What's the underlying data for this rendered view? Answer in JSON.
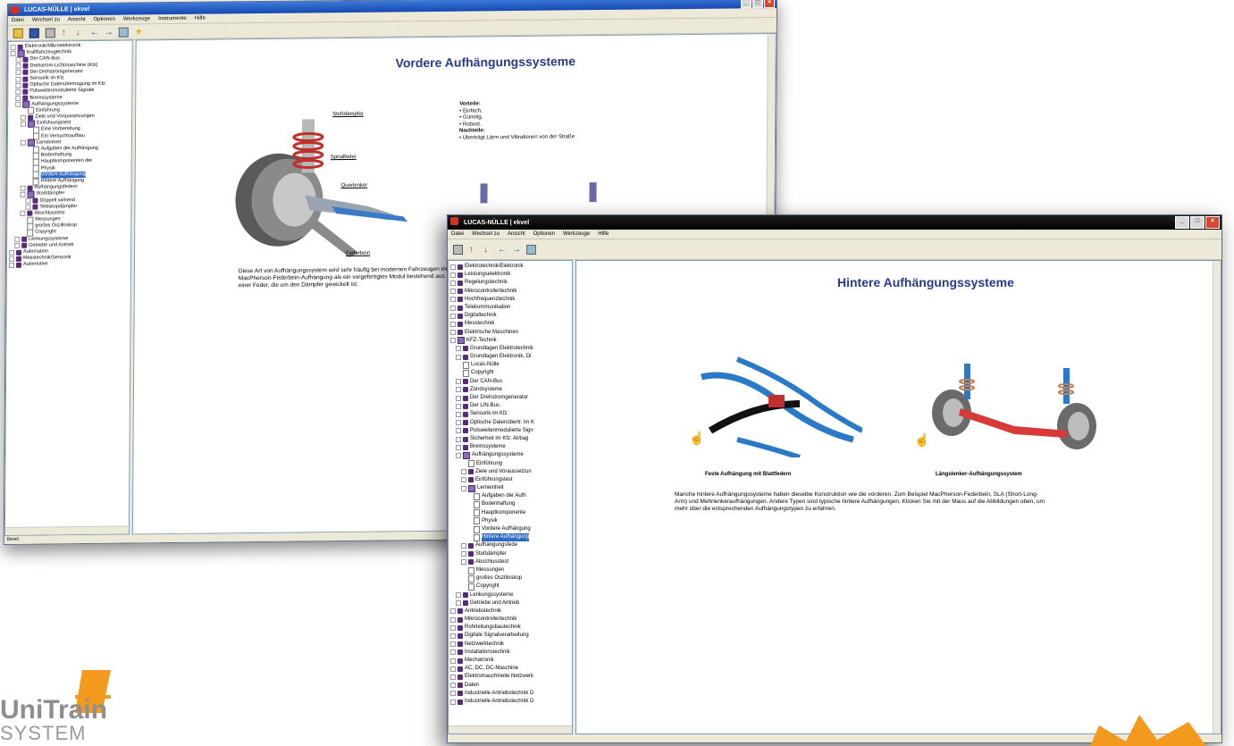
{
  "window1": {
    "title": "LUCAS-NÜLLE | ekvel",
    "menu": [
      "Datei",
      "Wechsel zu",
      "Ansicht",
      "Optionen",
      "Werkzeuge",
      "Instrumente",
      "Hilfe"
    ],
    "page_title": "Vordere Aufhängungssysteme",
    "pros_heading": "Vorteile:",
    "pros": [
      "Einfach,",
      "Günstig,",
      "Robust."
    ],
    "cons_heading": "Nachteile:",
    "cons": [
      "Überträgt Lärm und Vibrationen von der Straße"
    ],
    "labels": {
      "stossdaempfer": "Stoßdämpfer",
      "spiralfeder": "Spiralfeder",
      "querlenker": "Querlenker",
      "federbein": "Federbein"
    },
    "description": "Diese Art von Aufhängungssystem wird sehr häufig bei modernen Fahrzeugen eingesetzt. Ein Beispiel ist die MacPherson-Federbein-Aufhängung als ein vorgefertigtes Modul bestehend aus einem Arm, einem Stoßdämpfer und einer Feder, die um den Dämpfer gewickelt ist.",
    "status": "Bereit",
    "tree": [
      {
        "label": "Elektronik/Mikroelektronik",
        "lvl": 0,
        "icon": "book"
      },
      {
        "label": "Kraftfahrzeugtechnik",
        "lvl": 0,
        "icon": "open"
      },
      {
        "label": "Der CAN-Bus",
        "lvl": 1,
        "icon": "book"
      },
      {
        "label": "Drehstrom-Lichtmaschine (Kfz)",
        "lvl": 1,
        "icon": "book"
      },
      {
        "label": "Der Drehstromgenerator",
        "lvl": 1,
        "icon": "book"
      },
      {
        "label": "Sensorik im Kfz",
        "lvl": 1,
        "icon": "book"
      },
      {
        "label": "Optische Datenübertragung im Kfz",
        "lvl": 1,
        "icon": "book"
      },
      {
        "label": "Pulsweitenmodulierte Signale",
        "lvl": 1,
        "icon": "book"
      },
      {
        "label": "Bremssysteme",
        "lvl": 1,
        "icon": "book"
      },
      {
        "label": "Aufhängungssysteme",
        "lvl": 1,
        "icon": "open"
      },
      {
        "label": "Einführung",
        "lvl": 2,
        "icon": "page"
      },
      {
        "label": "Ziele und Voraussetzungen",
        "lvl": 2,
        "icon": "book"
      },
      {
        "label": "Einführungstest",
        "lvl": 2,
        "icon": "open"
      },
      {
        "label": "Eine Vorbereitung",
        "lvl": 3,
        "icon": "page"
      },
      {
        "label": "Ein Versuchsaufbau",
        "lvl": 3,
        "icon": "page"
      },
      {
        "label": "Lerneinheit",
        "lvl": 2,
        "icon": "open"
      },
      {
        "label": "Aufgaben der Aufhängung",
        "lvl": 3,
        "icon": "page"
      },
      {
        "label": "Bodenhaftung",
        "lvl": 3,
        "icon": "page"
      },
      {
        "label": "Hauptkomponenten der",
        "lvl": 3,
        "icon": "page"
      },
      {
        "label": "Physik",
        "lvl": 3,
        "icon": "page"
      },
      {
        "label": "Vordere Aufhängung",
        "lvl": 3,
        "icon": "page",
        "selected": true
      },
      {
        "label": "Hintere Aufhängung",
        "lvl": 3,
        "icon": "page"
      },
      {
        "label": "Aufhängungsfedern",
        "lvl": 2,
        "icon": "book"
      },
      {
        "label": "Stoßdämpfer",
        "lvl": 2,
        "icon": "open"
      },
      {
        "label": "Doppelt wirkend",
        "lvl": 3,
        "icon": "book"
      },
      {
        "label": "Teleskopdämpfer",
        "lvl": 3,
        "icon": "book"
      },
      {
        "label": "Abschlusstest",
        "lvl": 2,
        "icon": "book"
      },
      {
        "label": "Messungen",
        "lvl": 2,
        "icon": "page"
      },
      {
        "label": "großes Oszilloskop",
        "lvl": 2,
        "icon": "page"
      },
      {
        "label": "Copyright",
        "lvl": 2,
        "icon": "page"
      },
      {
        "label": "Lenkungssysteme",
        "lvl": 1,
        "icon": "book"
      },
      {
        "label": "Getriebe und Antrieb",
        "lvl": 1,
        "icon": "book"
      },
      {
        "label": "Automation",
        "lvl": 0,
        "icon": "book"
      },
      {
        "label": "Messtechnik/Sensorik",
        "lvl": 0,
        "icon": "book"
      },
      {
        "label": "Automotive",
        "lvl": 0,
        "icon": "book"
      }
    ]
  },
  "window2": {
    "title": "LUCAS-NÜLLE | ekvel",
    "menu": [
      "Datei",
      "Wechsel zu",
      "Ansicht",
      "Optionen",
      "Werkzeuge",
      "Hilfe"
    ],
    "page_title": "Hintere Aufhängungssysteme",
    "caption_left": "Feste Aufhängung mit Blattfedern",
    "caption_right": "Längslenker-Aufhängungssystem",
    "description": "Manche hintere Aufhängungssysteme haben dieselbe Konstruktion wie die vorderen. Zum Beispiel MacPherson-Federbein, SLA (Short-Long-Arm) und Mehrlenkeraufhängungen. Andere Typen sind typische hintere Aufhängungen. Klicken Sie mit der Maus auf die Abbildungen oben, um mehr über die entsprechenden Aufhängungstypen zu erfahren.",
    "tree": [
      {
        "label": "Elektrotechnik/Elektronik",
        "lvl": 0,
        "icon": "book"
      },
      {
        "label": "Leistungselektronik",
        "lvl": 0,
        "icon": "book"
      },
      {
        "label": "Regelungstechnik",
        "lvl": 0,
        "icon": "book"
      },
      {
        "label": "Mikrocontrollertechnik",
        "lvl": 0,
        "icon": "book"
      },
      {
        "label": "Hochfrequenztechnik",
        "lvl": 0,
        "icon": "book"
      },
      {
        "label": "Telekommunikation",
        "lvl": 0,
        "icon": "book"
      },
      {
        "label": "Digitaltechnik",
        "lvl": 0,
        "icon": "book"
      },
      {
        "label": "Messtechnik",
        "lvl": 0,
        "icon": "book"
      },
      {
        "label": "Elektrische Maschinen",
        "lvl": 0,
        "icon": "book"
      },
      {
        "label": "KFZ-Technik",
        "lvl": 0,
        "icon": "open"
      },
      {
        "label": "Grundlagen Elektrotechnik",
        "lvl": 1,
        "icon": "book"
      },
      {
        "label": "Grundlagen Elektronik, Di",
        "lvl": 1,
        "icon": "book"
      },
      {
        "label": "Lucas-Nülle",
        "lvl": 1,
        "icon": "page"
      },
      {
        "label": "Copyright",
        "lvl": 1,
        "icon": "page"
      },
      {
        "label": "Der CAN-Bus",
        "lvl": 1,
        "icon": "book"
      },
      {
        "label": "Zündsysteme",
        "lvl": 1,
        "icon": "book"
      },
      {
        "label": "Der Drehstromgenerator",
        "lvl": 1,
        "icon": "book"
      },
      {
        "label": "Der LIN-Bus",
        "lvl": 1,
        "icon": "book"
      },
      {
        "label": "Sensorik im Kfz",
        "lvl": 1,
        "icon": "book"
      },
      {
        "label": "Optische Datenübertr. im K",
        "lvl": 1,
        "icon": "book"
      },
      {
        "label": "Pulsweitenmodulierte Sign",
        "lvl": 1,
        "icon": "book"
      },
      {
        "label": "Sicherheit im Kfz: Airbag",
        "lvl": 1,
        "icon": "book"
      },
      {
        "label": "Bremssysteme",
        "lvl": 1,
        "icon": "book"
      },
      {
        "label": "Aufhängungssysteme",
        "lvl": 1,
        "icon": "open"
      },
      {
        "label": "Einführung",
        "lvl": 2,
        "icon": "page"
      },
      {
        "label": "Ziele und Voraussetzun",
        "lvl": 2,
        "icon": "book"
      },
      {
        "label": "Einführungstest",
        "lvl": 2,
        "icon": "book"
      },
      {
        "label": "Lerneinheit",
        "lvl": 2,
        "icon": "open"
      },
      {
        "label": "Aufgaben der Aufh",
        "lvl": 3,
        "icon": "page"
      },
      {
        "label": "Bodenhaftung",
        "lvl": 3,
        "icon": "page"
      },
      {
        "label": "Hauptkomponente",
        "lvl": 3,
        "icon": "page"
      },
      {
        "label": "Physik",
        "lvl": 3,
        "icon": "page"
      },
      {
        "label": "Vordere Aufhängung",
        "lvl": 3,
        "icon": "page"
      },
      {
        "label": "Hintere Aufhängung",
        "lvl": 3,
        "icon": "page",
        "selected": true
      },
      {
        "label": "Aufhängungsfede",
        "lvl": 2,
        "icon": "book"
      },
      {
        "label": "Stoßdämpfer",
        "lvl": 2,
        "icon": "book"
      },
      {
        "label": "Abschlusstest",
        "lvl": 2,
        "icon": "book"
      },
      {
        "label": "Messungen",
        "lvl": 2,
        "icon": "page"
      },
      {
        "label": "großes Oszilloskop",
        "lvl": 2,
        "icon": "page"
      },
      {
        "label": "Copyright",
        "lvl": 2,
        "icon": "page"
      },
      {
        "label": "Lenkungssysteme",
        "lvl": 1,
        "icon": "book"
      },
      {
        "label": "Getriebe und Antrieb",
        "lvl": 1,
        "icon": "book"
      },
      {
        "label": "Antriebstechnik",
        "lvl": 0,
        "icon": "book"
      },
      {
        "label": "Mikrocontrollertechnik",
        "lvl": 0,
        "icon": "book"
      },
      {
        "label": "Rohrleitungsbautechnik",
        "lvl": 0,
        "icon": "book"
      },
      {
        "label": "Digitale Signalverarbeitung",
        "lvl": 0,
        "icon": "book"
      },
      {
        "label": "Netzwerktechnik",
        "lvl": 0,
        "icon": "book"
      },
      {
        "label": "Installationstechnik",
        "lvl": 0,
        "icon": "book"
      },
      {
        "label": "Mechatronik",
        "lvl": 0,
        "icon": "book"
      },
      {
        "label": "AC, DC, DC-Maschine",
        "lvl": 0,
        "icon": "book"
      },
      {
        "label": "Elektromaschinelle Netzwerk",
        "lvl": 0,
        "icon": "book"
      },
      {
        "label": "Daten",
        "lvl": 0,
        "icon": "book"
      },
      {
        "label": "Industrielle Antriebstechnik D",
        "lvl": 0,
        "icon": "book"
      },
      {
        "label": "Industrielle Antriebstechnik D",
        "lvl": 0,
        "icon": "book"
      }
    ]
  },
  "logo": {
    "brand_top": "UniTrain",
    "brand_bottom": "SYSTEM",
    "colors": {
      "gray": "#8e8e8e",
      "orange": "#f39a1e"
    }
  },
  "colors": {
    "accent": "#2a3a8a",
    "selection": "#316ac5",
    "spring_red": "#c0302a",
    "axle_blue": "#2a7ac8"
  }
}
